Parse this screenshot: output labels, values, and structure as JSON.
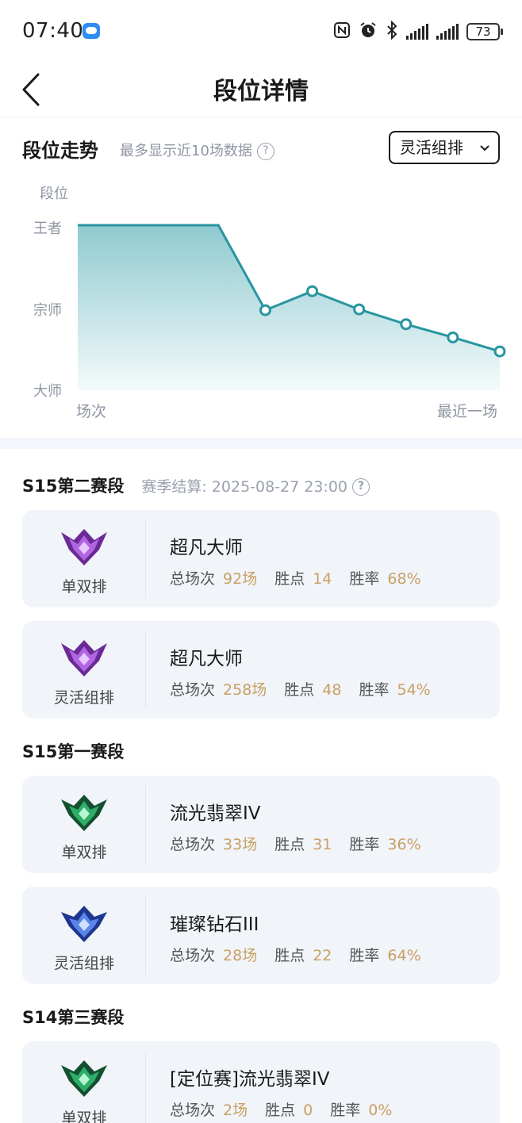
{
  "status": {
    "time": "07:40",
    "battery": "73"
  },
  "nav": {
    "title": "段位详情"
  },
  "trend": {
    "title": "段位走势",
    "subtitle": "最多显示近10场数据",
    "help": "?",
    "dropdown": "灵活组排",
    "dropdown_chevron": "⌄",
    "y_axis_title": "段位",
    "x_start_label": "场次",
    "x_end_label": "最近一场"
  },
  "chart_data": {
    "type": "area",
    "ylabel": "段位",
    "y_ticks": [
      "王者",
      "宗师",
      "大师"
    ],
    "x_labels": [
      "场次",
      "最近一场"
    ],
    "note": "",
    "points": [
      {
        "x": 1,
        "y": 3.0
      },
      {
        "x": 2,
        "y": 3.0
      },
      {
        "x": 3,
        "y": 3.0
      },
      {
        "x": 4,
        "y": 3.0
      },
      {
        "x": 5,
        "y": 1.97
      },
      {
        "x": 6,
        "y": 2.2
      },
      {
        "x": 7,
        "y": 1.98
      },
      {
        "x": 8,
        "y": 1.8
      },
      {
        "x": 9,
        "y": 1.64
      },
      {
        "x": 10,
        "y": 1.47
      }
    ],
    "marked_from_index": 4,
    "ylim": [
      1,
      3
    ],
    "line_color": "#2896a0",
    "fill_top_color": "#8fcad0",
    "fill_bottom_color": "#f4fafb"
  },
  "seasons": [
    {
      "title": "S15第二赛段",
      "note": "赛季结算: 2025-08-27 23:00",
      "cards": [
        {
          "queue": "单双排",
          "rank": "超凡大师",
          "emblem": "master",
          "games_label": "总场次",
          "games": "92场",
          "lp_label": "胜点",
          "lp": "14",
          "wr_label": "胜率",
          "wr": "68%"
        },
        {
          "queue": "灵活组排",
          "rank": "超凡大师",
          "emblem": "master",
          "games_label": "总场次",
          "games": "258场",
          "lp_label": "胜点",
          "lp": "48",
          "wr_label": "胜率",
          "wr": "54%"
        }
      ]
    },
    {
      "title": "S15第一赛段",
      "note": "",
      "cards": [
        {
          "queue": "单双排",
          "rank": "流光翡翠IV",
          "emblem": "emerald",
          "games_label": "总场次",
          "games": "33场",
          "lp_label": "胜点",
          "lp": "31",
          "wr_label": "胜率",
          "wr": "36%"
        },
        {
          "queue": "灵活组排",
          "rank": "璀璨钻石III",
          "emblem": "diamond",
          "games_label": "总场次",
          "games": "28场",
          "lp_label": "胜点",
          "lp": "22",
          "wr_label": "胜率",
          "wr": "64%"
        }
      ]
    },
    {
      "title": "S14第三赛段",
      "note": "",
      "cards": [
        {
          "queue": "单双排",
          "rank": "[定位赛]流光翡翠IV",
          "emblem": "emerald",
          "games_label": "总场次",
          "games": "2场",
          "lp_label": "胜点",
          "lp": "0",
          "wr_label": "胜率",
          "wr": "0%"
        }
      ]
    }
  ],
  "colors": {
    "accent_value": "#c9a063",
    "card_bg": "#f1f4f9",
    "master_emblem": "#8a3fb8",
    "emerald_emblem": "#1e8a55",
    "diamond_emblem": "#3b5fd0"
  }
}
